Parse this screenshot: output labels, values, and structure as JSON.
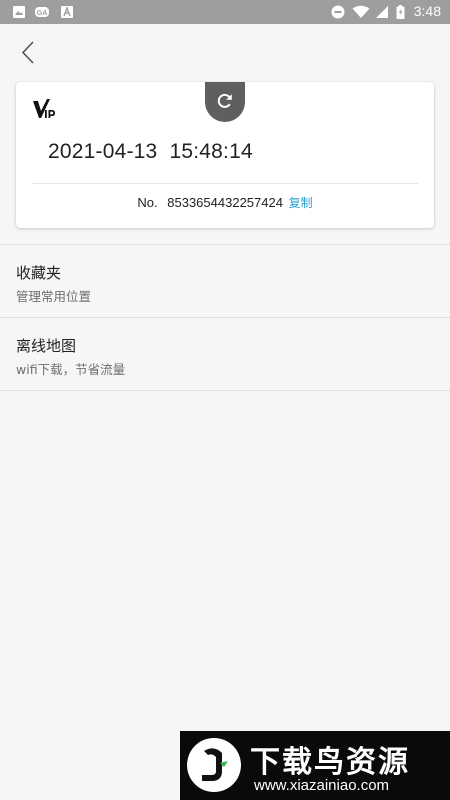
{
  "status_bar": {
    "time": "3:48",
    "icons": [
      "image-icon",
      "game-controller-icon",
      "text-icon",
      "do-not-disturb-icon",
      "wifi-icon",
      "signal-icon",
      "battery-icon"
    ]
  },
  "nav": {
    "back_icon": "chevron-left-icon"
  },
  "vip_card": {
    "logo_icon": "vip-logo-icon",
    "refresh_icon": "refresh-icon",
    "datetime": "2021-04-13  15:48:14",
    "number_prefix": "No.",
    "number": "8533654432257424",
    "copy_label": "复制",
    "colors": {
      "copy": "#2a9fd6",
      "refresh_bg": "#5f5f5f"
    }
  },
  "menu": [
    {
      "title": "收藏夹",
      "subtitle": "管理常用位置"
    },
    {
      "title": "离线地图",
      "subtitle": "wifi下载，节省流量"
    }
  ],
  "watermark": {
    "text": "下载鸟资源",
    "url": "www.xiazainiao.com"
  }
}
